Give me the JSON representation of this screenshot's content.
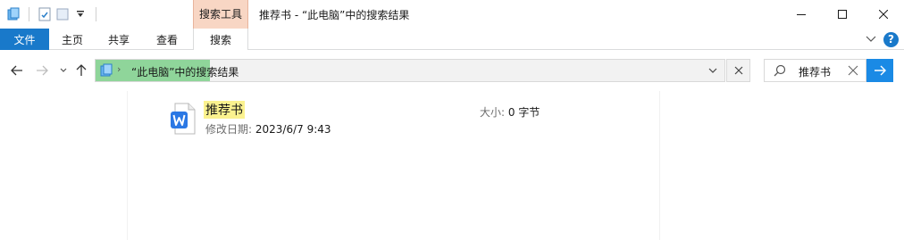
{
  "window": {
    "title": "推荐书 - “此电脑”中的搜索结果",
    "context_tab_group": "搜索工具"
  },
  "ribbon": {
    "tabs": [
      "文件",
      "主页",
      "共享",
      "查看",
      "搜索"
    ],
    "active_tab": "搜索",
    "file_tab_color": "#1979ca"
  },
  "address_bar": {
    "path": "“此电脑”中的搜索结果",
    "progress_color": "#8fd59a"
  },
  "search": {
    "value": "推荐书",
    "go_button_color": "#1a8ae5"
  },
  "results": [
    {
      "name": "推荐书",
      "modified_label": "修改日期:",
      "modified_value": "2023/6/7 9:43",
      "size_label": "大小:",
      "size_value": "0 字节",
      "icon": "wps-writer-doc-icon",
      "highlight_color": "#fbf28f"
    }
  ]
}
